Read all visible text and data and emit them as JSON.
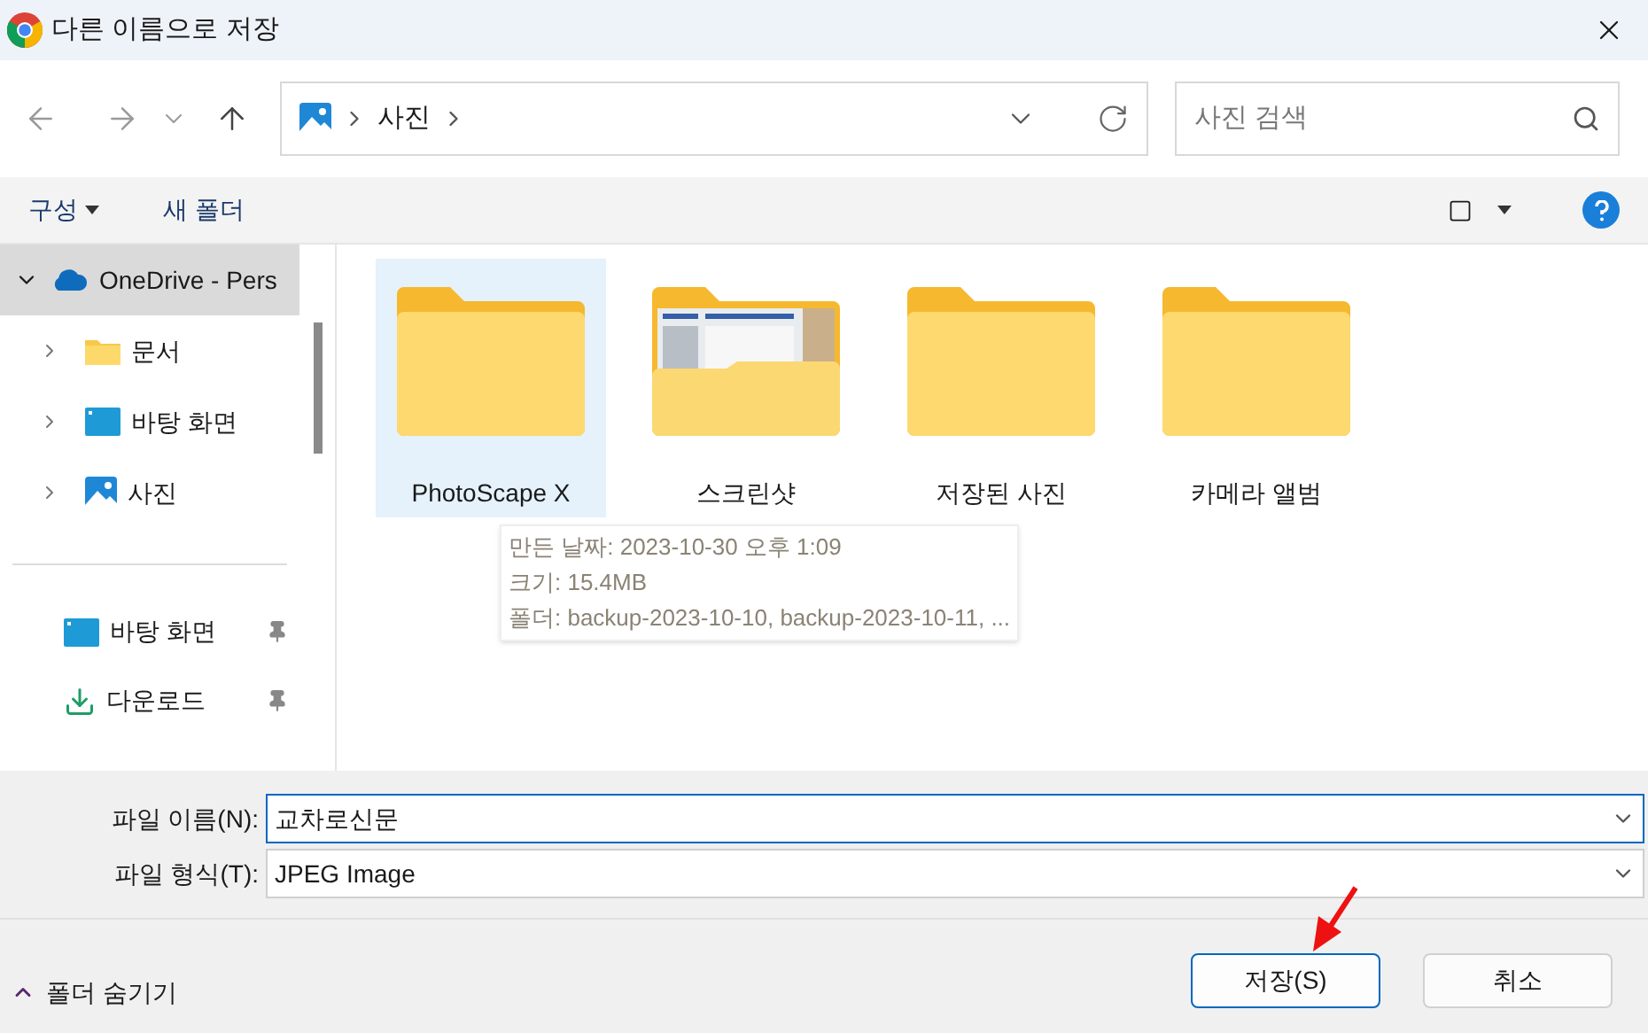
{
  "window": {
    "title": "다른 이름으로 저장"
  },
  "address": {
    "crumbs": [
      "사진"
    ]
  },
  "search": {
    "placeholder": "사진 검색"
  },
  "toolbar": {
    "organize": "구성",
    "new_folder": "새 폴더"
  },
  "sidebar": {
    "tree": [
      {
        "label": "OneDrive - Pers",
        "kind": "cloud",
        "expanded": true,
        "selected": true,
        "children": [
          {
            "label": "문서",
            "kind": "folder",
            "expanded": false,
            "selected": false
          },
          {
            "label": "바탕 화면",
            "kind": "desktop",
            "expanded": false,
            "selected": false
          },
          {
            "label": "사진",
            "kind": "pictures",
            "expanded": false,
            "selected": false
          }
        ]
      }
    ],
    "quick": [
      {
        "label": "바탕 화면",
        "kind": "desktop",
        "pinned": true
      },
      {
        "label": "다운로드",
        "kind": "download",
        "pinned": true
      }
    ]
  },
  "folders": [
    {
      "name": "PhotoScape X",
      "kind": "plain",
      "selected": true
    },
    {
      "name": "스크린샷",
      "kind": "preview",
      "selected": false
    },
    {
      "name": "저장된 사진",
      "kind": "plain",
      "selected": false
    },
    {
      "name": "카메라 앨범",
      "kind": "plain",
      "selected": false
    }
  ],
  "tooltip": [
    "만든 날짜: 2023-10-30 오후 1:09",
    "크기: 15.4MB",
    "폴더: backup-2023-10-10, backup-2023-10-11, ..."
  ],
  "fields": [
    {
      "label": "파일 이름(N):",
      "value": "교차로신문",
      "focused": true
    },
    {
      "label": "파일 형식(T):",
      "value": "JPEG Image",
      "focused": false
    }
  ],
  "hide_folders": "폴더 숨기기",
  "buttons": [
    {
      "label": "저장(S)",
      "primary": true
    },
    {
      "label": "취소",
      "primary": false
    }
  ]
}
